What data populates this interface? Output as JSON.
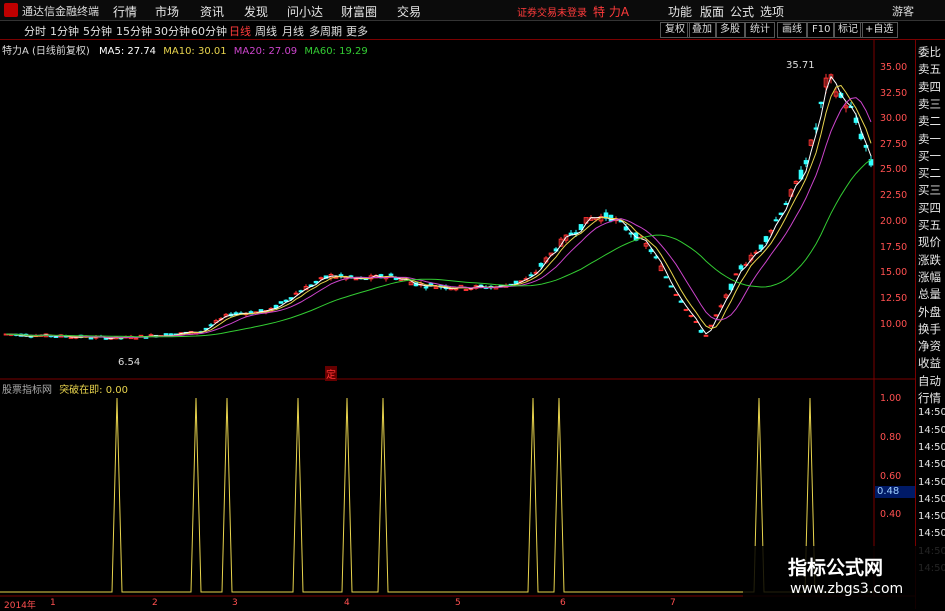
{
  "app": {
    "title": "通达信金融终端",
    "guest": "游客"
  },
  "menu": [
    "行情",
    "市场",
    "资讯",
    "发现",
    "问小达",
    "财富圈",
    "交易"
  ],
  "status": {
    "login": "证券交易未登录",
    "stock": "特 力A"
  },
  "tools": [
    "功能",
    "版面",
    "公式",
    "选项"
  ],
  "periods": [
    "分时",
    "1分钟",
    "5分钟",
    "15分钟",
    "30分钟",
    "60分钟",
    "日线",
    "周线",
    "月线",
    "多周期",
    "更多"
  ],
  "active_period": "日线",
  "right_buttons": [
    "复权",
    "叠加",
    "多股",
    "统计",
    "画线",
    "F10",
    "标记",
    "+自选"
  ],
  "chart_info": {
    "name": "特力A",
    "mode": "(日线前复权)",
    "ma5": "MA5: 27.74",
    "ma10": "MA10: 30.01",
    "ma20": "MA20: 27.09",
    "ma60": "MA60: 19.29"
  },
  "colors": {
    "ma5": "#ffffff",
    "ma10": "#e8d44d",
    "ma20": "#cc44cc",
    "ma60": "#33cc33",
    "up": "#ff3333",
    "down": "#33ffff"
  },
  "sidebar": [
    "委比",
    "卖五",
    "卖四",
    "卖三",
    "卖二",
    "卖一",
    "买一",
    "买二",
    "买三",
    "买四",
    "买五",
    "现价",
    "涨跌",
    "涨幅",
    "总量",
    "外盘",
    "换手",
    "净资",
    "收益",
    "自动",
    "行情",
    "14:50",
    "14:50",
    "14:50",
    "14:50",
    "14:50",
    "14:50",
    "14:50",
    "14:50",
    "14:50",
    "14:50"
  ],
  "price_axis": [
    "35.00",
    "32.50",
    "30.00",
    "27.50",
    "25.00",
    "22.50",
    "20.00",
    "17.50",
    "15.00",
    "12.50",
    "10.00"
  ],
  "annotations": {
    "high": "35.71",
    "low": "6.54",
    "marker": "定"
  },
  "indicator": {
    "source": "股票指标网",
    "name": "突破在即:",
    "value": "0.00",
    "highlight": "0.48",
    "axis": [
      "1.00",
      "0.80",
      "0.60",
      "0.40"
    ]
  },
  "dates": [
    "2014年",
    "1",
    "2",
    "3",
    "4",
    "5",
    "6",
    "7"
  ],
  "watermark": {
    "line1": "指标公式网",
    "line2": "www.zbgs3.com"
  }
}
